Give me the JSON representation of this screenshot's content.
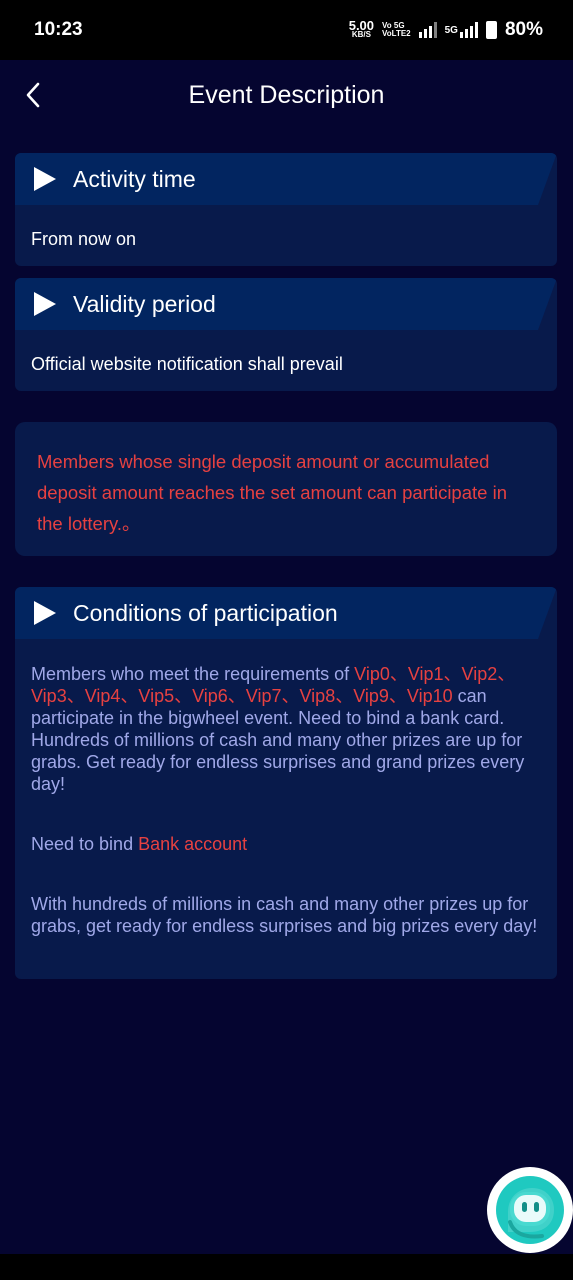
{
  "status_bar": {
    "time": "10:23",
    "net_speed": "5.00",
    "net_unit": "KB/S",
    "volte_top": "Vo 5G",
    "volte_bottom": "VoLTE2",
    "network_type": "5G",
    "battery": "80%"
  },
  "header": {
    "title": "Event Description"
  },
  "sections": {
    "activity": {
      "title": "Activity time",
      "body": "From now on"
    },
    "validity": {
      "title": "Validity period",
      "body": "Official website notification shall prevail"
    },
    "notice": {
      "text": "Members whose single deposit amount or accumulated deposit amount reaches the set amount can participate in the lottery.。"
    },
    "conditions": {
      "title": "Conditions of participation",
      "p1_prefix": "Members who meet the requirements of ",
      "p1_levels": "Vip0、Vip1、Vip2、Vip3、Vip4、Vip5、Vip6、Vip7、Vip8、Vip9、Vip10",
      "p1_suffix": " can participate in the bigwheel event. Need to bind a bank card. Hundreds of millions of cash and many other prizes are up for grabs. Get ready for endless surprises and grand prizes every day!",
      "p2_prefix": "Need to bind ",
      "p2_link": "Bank account",
      "p3": "With hundreds of millions in cash and many other prizes up for grabs, get ready for endless surprises and big prizes every day!"
    }
  },
  "icons": {
    "back": "chevron-left-icon",
    "section": "play-triangle-icon",
    "chat": "chat-bot-icon"
  },
  "colors": {
    "background": "#050530",
    "card": "#081a4b",
    "card_header": "#022560",
    "highlight_red": "#e64141",
    "body_text": "#a0a8e8",
    "chat_accent": "#1fc9c0"
  }
}
